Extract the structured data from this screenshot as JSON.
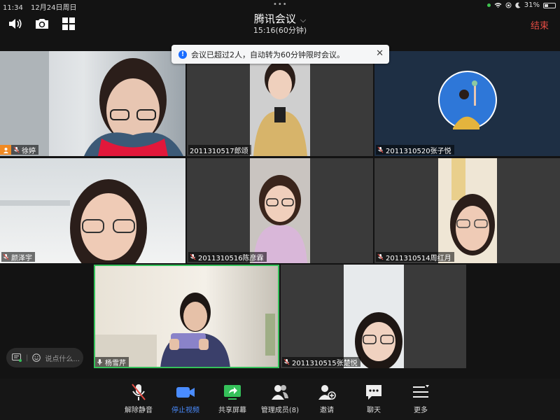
{
  "status_bar": {
    "time": "11:34",
    "date": "12月24日周日",
    "battery": "31%"
  },
  "meeting": {
    "title": "腾讯会议",
    "timer": "15:16(60分钟)",
    "end_label": "结束"
  },
  "notice": {
    "text": "会议已超过2人，自动转为60分钟限时会议。"
  },
  "participants": [
    {
      "name": "徐婷"
    },
    {
      "name": "2011310517郎颂"
    },
    {
      "name": "2011310520张子悦"
    },
    {
      "name": "颜泽宇"
    },
    {
      "name": "2011310516陈彦霖"
    },
    {
      "name": "2011310514周红月"
    },
    {
      "name": "杨雪芹"
    },
    {
      "name": "2011310515张楚悦"
    }
  ],
  "chat": {
    "placeholder": "说点什么..."
  },
  "toolbar": {
    "unmute": "解除静音",
    "stop_video": "停止视频",
    "share_screen": "共享屏幕",
    "manage_members": "管理成员(8)",
    "invite": "邀请",
    "chat": "聊天",
    "more": "更多"
  },
  "colors": {
    "end": "#e34b43",
    "accent": "#4a8cff",
    "active_speaker": "#35c15a"
  }
}
